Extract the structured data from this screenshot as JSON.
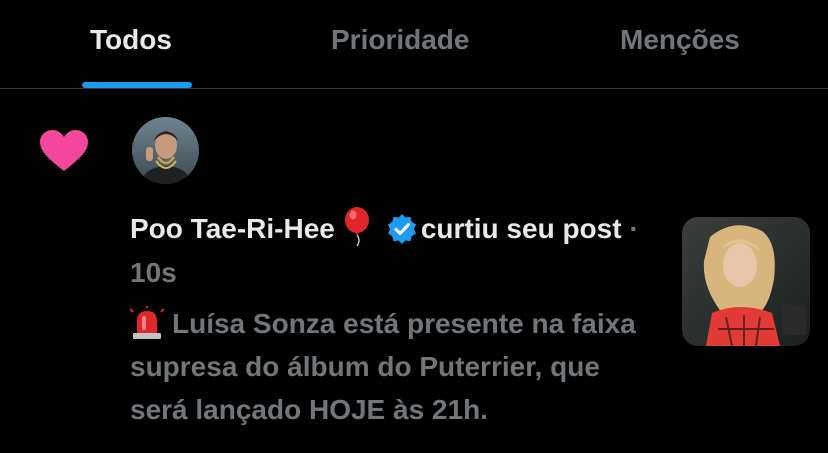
{
  "tabs": [
    {
      "label": "Todos",
      "active": true
    },
    {
      "label": "Prioridade",
      "active": false
    },
    {
      "label": "Menções",
      "active": false
    }
  ],
  "notification": {
    "type_icon": "heart-icon",
    "user_name": "Poo Tae-Ri-Hee",
    "user_emoji": "balloon-icon",
    "verified": true,
    "action_text": "curtiu seu post",
    "separator": "·",
    "time": "10s",
    "post_emoji": "siren-icon",
    "post_text": "Luísa Sonza está presente na faixa supresa do álbum do Puterrier, que será lançado HOJE às 21h."
  },
  "colors": {
    "background": "#000000",
    "text_primary": "#e7e9ea",
    "text_secondary": "#71767b",
    "accent": "#1d9bf0",
    "heart": "#f2479c",
    "divider": "#2f3336"
  }
}
